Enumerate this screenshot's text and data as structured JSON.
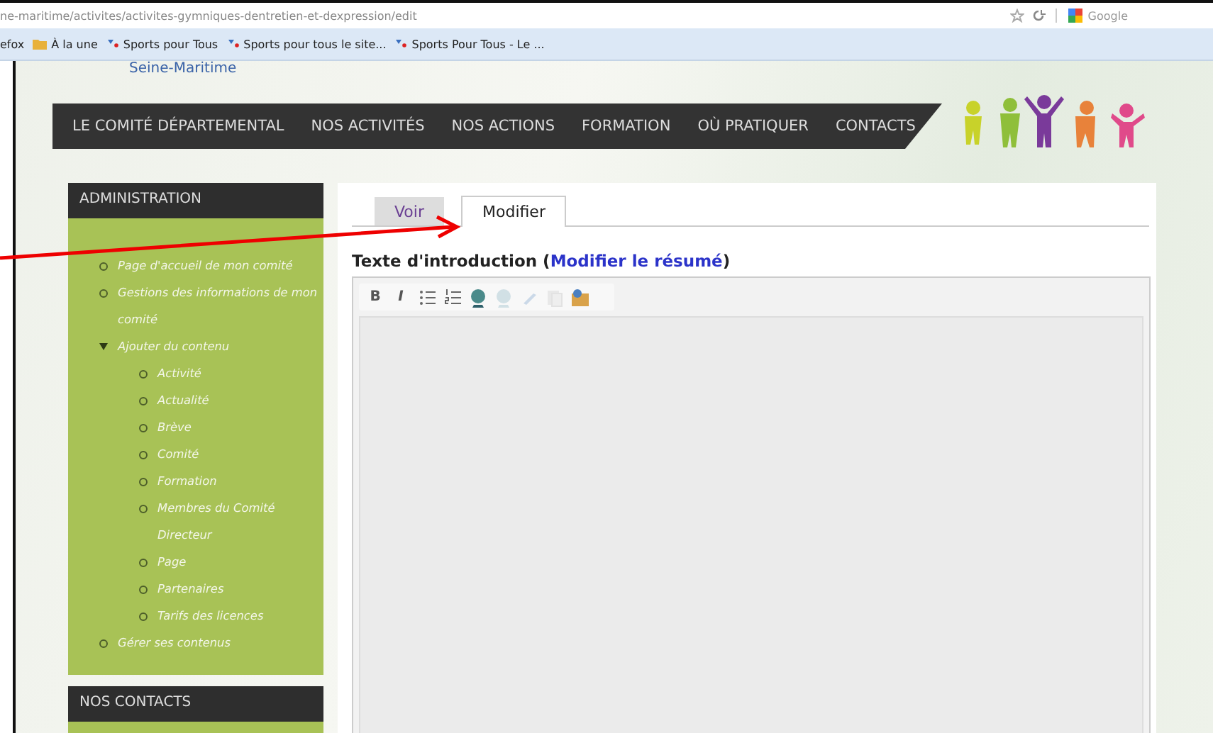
{
  "browser": {
    "url": "ne-maritime/activites/activites-gymniques-dentretien-et-dexpression/edit",
    "search_placeholder": "Google",
    "bookmarks": [
      {
        "kind": "text",
        "label": "efox"
      },
      {
        "kind": "folder",
        "label": "À la une"
      },
      {
        "kind": "feed",
        "label": "Sports pour Tous"
      },
      {
        "kind": "feed",
        "label": "Sports pour tous le site..."
      },
      {
        "kind": "feed",
        "label": "Sports Pour Tous - Le ..."
      }
    ]
  },
  "site": {
    "subtitle": "Seine-Maritime",
    "nav": [
      "LE COMITÉ DÉPARTEMENTAL",
      "NOS ACTIVITÉS",
      "NOS ACTIONS",
      "FORMATION",
      "OÙ PRATIQUER",
      "CONTACTS"
    ]
  },
  "sidebar": {
    "title": "ADMINISTRATION",
    "items": [
      {
        "label": "Page d'accueil de mon comité"
      },
      {
        "label": "Gestions des informations de mon comité"
      },
      {
        "label": "Ajouter du contenu",
        "expanded": true,
        "children": [
          {
            "label": "Activité"
          },
          {
            "label": "Actualité"
          },
          {
            "label": "Brève"
          },
          {
            "label": "Comité"
          },
          {
            "label": "Formation"
          },
          {
            "label": "Membres du Comité Directeur"
          },
          {
            "label": "Page"
          },
          {
            "label": "Partenaires"
          },
          {
            "label": "Tarifs des licences"
          }
        ]
      },
      {
        "label": "Gérer ses contenus"
      }
    ],
    "contacts_title": "NOS CONTACTS"
  },
  "tabs": [
    {
      "label": "Voir",
      "selected": false
    },
    {
      "label": "Modifier",
      "selected": true
    }
  ],
  "editor": {
    "heading": "Texte d'introduction (",
    "link": "Modifier le résumé",
    "heading_end": ")",
    "toolbar": [
      {
        "kind": "bold",
        "label": "B",
        "disabled": false
      },
      {
        "kind": "italic",
        "label": "I",
        "disabled": false
      },
      {
        "kind": "bullets",
        "disabled": false
      },
      {
        "kind": "numbers",
        "disabled": false
      },
      {
        "kind": "link",
        "disabled": false
      },
      {
        "kind": "unlink",
        "disabled": true
      },
      {
        "kind": "anchor",
        "disabled": true
      },
      {
        "kind": "paste",
        "disabled": true
      },
      {
        "kind": "image",
        "disabled": false
      }
    ]
  }
}
